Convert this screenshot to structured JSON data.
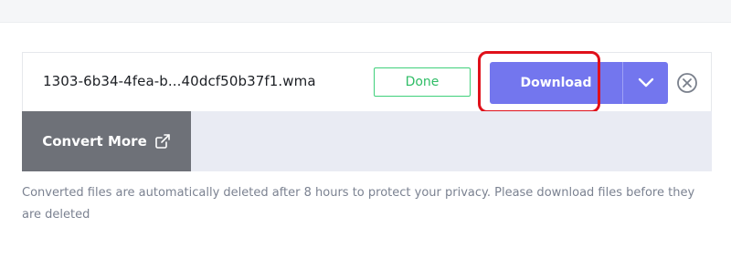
{
  "file": {
    "name": "1303-6b34-4fea-b...40dcf50b37f1.wma",
    "status": "Done"
  },
  "actions": {
    "download_label": "Download",
    "dropdown_icon": "chevron-down-icon",
    "close_icon": "close-circle-icon",
    "convert_more_label": "Convert More",
    "convert_more_icon": "external-link-icon"
  },
  "notice": {
    "text": "Converted files are automatically deleted after 8 hours to protect your privacy. Please download files before they are deleted"
  },
  "colors": {
    "accent": "#7376ee",
    "success": "#2fbd66",
    "highlight": "#e0101a",
    "secondary_button": "#6e7178"
  }
}
